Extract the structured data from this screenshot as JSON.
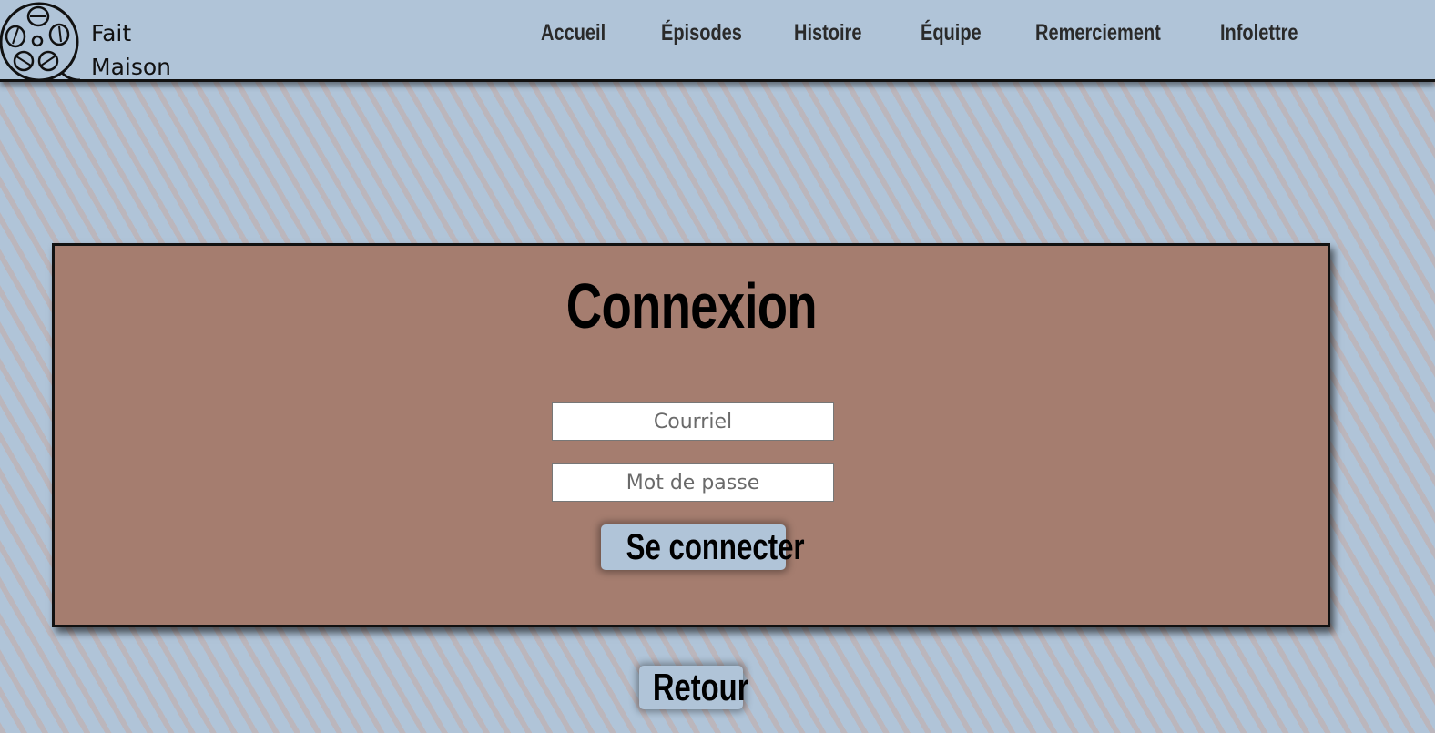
{
  "header": {
    "logo_line1": "Fait",
    "logo_line2": "Maison",
    "logo_icon": "film-reel-icon"
  },
  "nav": {
    "items": [
      {
        "label": "Accueil"
      },
      {
        "label": "Épisodes"
      },
      {
        "label": "Histoire"
      },
      {
        "label": "Équipe"
      },
      {
        "label": "Remerciement"
      },
      {
        "label": "Infolettre"
      }
    ]
  },
  "login": {
    "title": "Connexion",
    "email_placeholder": "Courriel",
    "password_placeholder": "Mot de passe",
    "submit_label": "Se connecter"
  },
  "footer": {
    "back_label": "Retour"
  },
  "colors": {
    "header_bg": "#b0c4d8",
    "card_bg": "#a57d6f",
    "button_bg": "#b0c4d8"
  }
}
